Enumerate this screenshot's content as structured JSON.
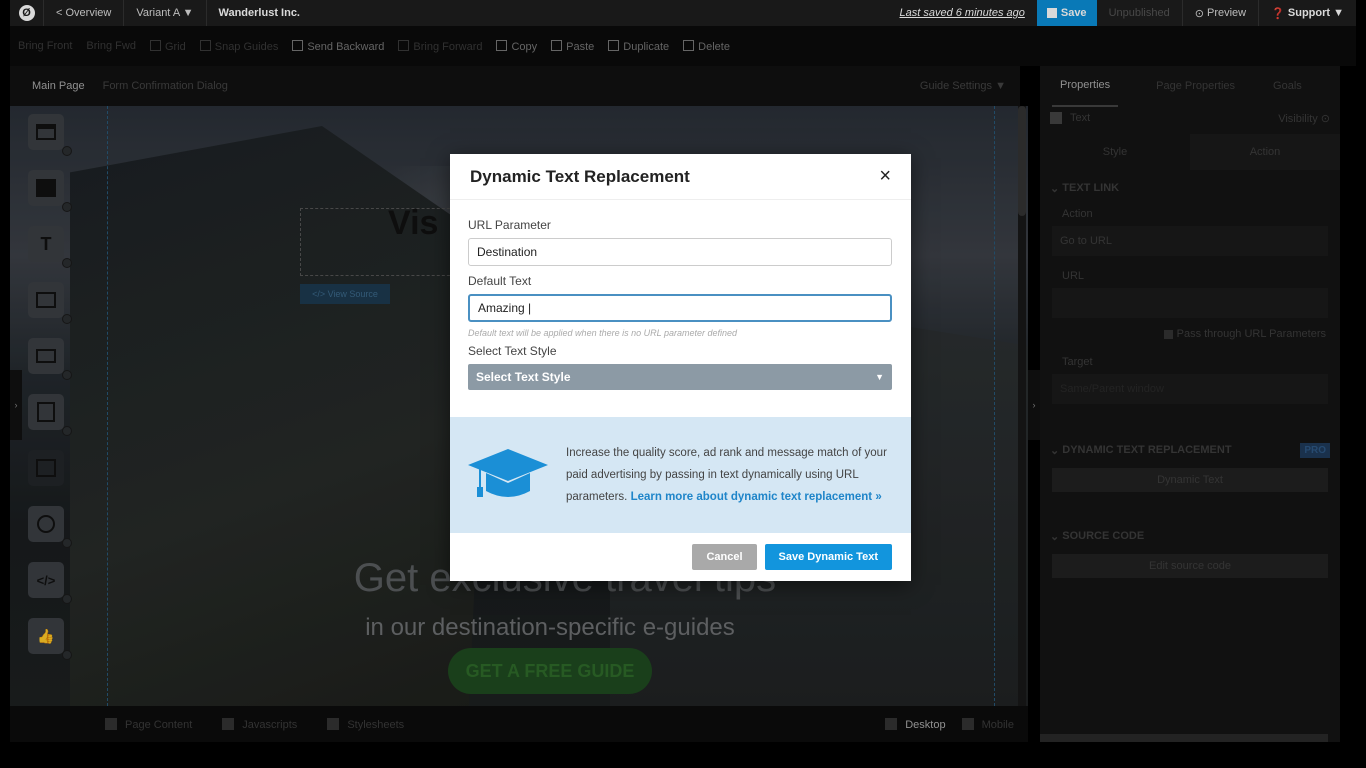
{
  "topbar": {
    "logo": "Ø",
    "overview": "< Overview",
    "variant": "Variant A ▼",
    "title": "Wanderlust Inc.",
    "last_saved": "Last saved  6 minutes ago",
    "save": "Save",
    "unpublished": "Unpublished",
    "preview": "Preview",
    "support": "Support ▼"
  },
  "toolbar": {
    "items": [
      "Bring Front",
      "Bring Fwd",
      "Grid",
      "Snap Guides",
      "Send Backward",
      "Bring Forward",
      "Copy",
      "Paste",
      "Duplicate",
      "Delete"
    ]
  },
  "page_tabs": {
    "main": "Main Page",
    "confirm": "Form Confirmation Dialog",
    "guide": "Guide Settings ▼"
  },
  "canvas": {
    "vis_text": "Vis",
    "view_source": "</> View Source",
    "headline": "Get exclusive travel tips",
    "sub": "in our destination-specific e-guides",
    "cta": "GET A FREE GUIDE"
  },
  "palette": {
    "text_tool": "T"
  },
  "bottombar": {
    "page_content": "Page Content",
    "javascripts": "Javascripts",
    "stylesheets": "Stylesheets",
    "desktop": "Desktop",
    "mobile": "Mobile"
  },
  "right_panel": {
    "tabs": [
      "Properties",
      "Page Properties",
      "Goals"
    ],
    "element": "Text",
    "visibility": "Visibility",
    "subtabs": [
      "Style",
      "Action"
    ],
    "text_link": "TEXT LINK",
    "action_label": "Action",
    "action_value": "Go to URL",
    "url_label": "URL",
    "pass_through": "Pass through URL Parameters",
    "target_label": "Target",
    "target_value": "Same/Parent window",
    "dtr_section": "DYNAMIC TEXT REPLACEMENT",
    "pro": "PRO",
    "dynamic_text_btn": "Dynamic Text",
    "source_code": "SOURCE CODE",
    "edit_source": "Edit source code"
  },
  "modal": {
    "title": "Dynamic Text Replacement",
    "close": "×",
    "url_param_label": "URL Parameter",
    "url_param_value": "Destination",
    "default_text_label": "Default Text",
    "default_text_value": "Amazing |",
    "hint": "Default text will be applied when there is no URL parameter defined",
    "style_label": "Select Text Style",
    "style_value": "Select Text Style",
    "info_text": "Increase the quality score, ad rank and message match of your paid advertising by passing in text dynamically using URL parameters. ",
    "info_link": "Learn more about dynamic text replacement »",
    "cancel": "Cancel",
    "save": "Save Dynamic Text"
  },
  "colors": {
    "accent": "#1295dd",
    "info_bg": "#d5e7f4",
    "select_bg": "#8c9aa5"
  }
}
